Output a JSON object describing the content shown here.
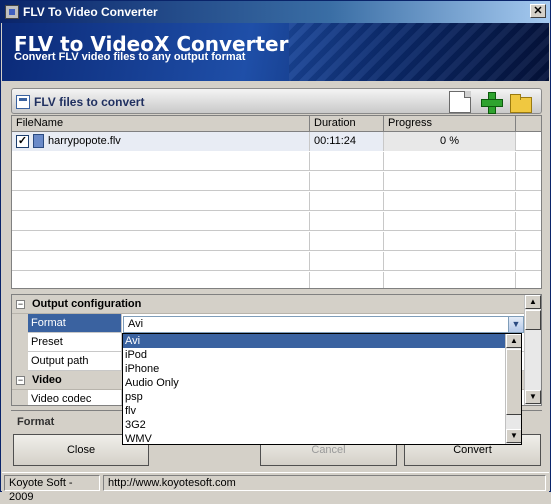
{
  "window": {
    "title": "FLV To Video Converter",
    "close_label": "✕"
  },
  "banner": {
    "title": "FLV to VideoX Converter",
    "subtitle": "Convert FLV video files to any output format"
  },
  "files_panel": {
    "title": "FLV files to convert",
    "columns": [
      "FileName",
      "Duration",
      "Progress"
    ],
    "rows": [
      {
        "checked": true,
        "check_glyph": "✓",
        "filename": "harrypopote.flv",
        "duration": "00:11:24",
        "progress": "0 %"
      }
    ]
  },
  "config": {
    "category_output": "Output configuration",
    "category_video": "Video",
    "toggle_glyph": "−",
    "labels": {
      "format": "Format",
      "preset": "Preset",
      "output_path": "Output path",
      "video_codec": "Video codec"
    },
    "format_value": "Avi",
    "format_options": [
      "Avi",
      "iPod",
      "iPhone",
      "Audio Only",
      "psp",
      "flv",
      "3G2",
      "WMV"
    ],
    "selected_option": "Avi"
  },
  "description_bar": {
    "label": "Format"
  },
  "buttons": {
    "close": "Close",
    "cancel": "Cancel",
    "convert": "Convert"
  },
  "status": {
    "company": "Koyote Soft - 2009",
    "url": "http://www.koyotesoft.com"
  },
  "glyphs": {
    "dropdown_arrow": "▼",
    "scroll_up": "▲",
    "scroll_down": "▼"
  },
  "colors": {
    "title_start": "#0a246a",
    "selection": "#3a62a0",
    "banner": "#1f4fa8"
  }
}
